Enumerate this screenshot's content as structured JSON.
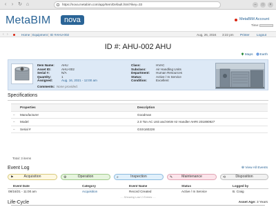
{
  "browser": {
    "url": "https://nova.metabim.com/app/Item/Default.html?ikey=33"
  },
  "header": {
    "logo": "MetaBIM",
    "badge": "nova",
    "account": "MetaBIM Account",
    "timer_label": "Time:"
  },
  "breadcrumb": {
    "home": "Home",
    "equipment": "Equipment",
    "asset": "ID #AHU-002",
    "date": "Aug, 26, 2024",
    "time": "3:22 pm",
    "print": "Printer",
    "logout": "Logout"
  },
  "page": {
    "title": "ID #:  AHU-002  AHU",
    "maps_link": "Maps",
    "earth_link": "Earth"
  },
  "asset": {
    "left": [
      {
        "k": "Item Name:",
        "v": "AHU"
      },
      {
        "k": "Asset ID:",
        "v": "AHU-002"
      },
      {
        "k": "Serial #:",
        "v": "N/A"
      },
      {
        "k": "Quantity:",
        "v": "1"
      },
      {
        "k": "Assigned:",
        "v": "Aug. 16, 2021 - 12:00 am"
      }
    ],
    "right": [
      {
        "k": "Class:",
        "v": "HVAC"
      },
      {
        "k": "Subclass:",
        "v": "Air Handling Units"
      },
      {
        "k": "Department:",
        "v": "Human Resources"
      },
      {
        "k": "Status:",
        "v": "Active / In Service"
      },
      {
        "k": "Condition:",
        "v": "Excellent"
      }
    ],
    "comments_label": "Comments:",
    "comments_value": "None provided."
  },
  "specs": {
    "title": "Specifications",
    "headers": [
      "Properties",
      "Description"
    ],
    "rows": [
      {
        "prop": "Manufacturer",
        "desc": "Goodman"
      },
      {
        "prop": "Model",
        "desc": "2.0 Ton AC Unit and 6KW Air Handler AHRI 201890927"
      },
      {
        "prop": "Serial #",
        "desc": "GSX160228"
      }
    ],
    "total": "Total: 3 items"
  },
  "event_log": {
    "title": "Event Log",
    "view_all": "View All Events",
    "stages": [
      "Acquisition",
      "Operation",
      "Inspection",
      "Maintenance",
      "Disposition"
    ],
    "headers": [
      "Event Date",
      "Category",
      "Event Name",
      "Status",
      "Logged by"
    ],
    "rows": [
      {
        "date": "08/16/21 - 11:00 am",
        "category": "Acquisition",
        "name": "Record Created",
        "status": "Active / In Service",
        "by": "B. Craig"
      }
    ],
    "showing": "- - Showing Last 1 Events - -"
  },
  "life_cycle": {
    "title": "Life-Cycle",
    "age_label": "Asset Age:",
    "age_value": "3 Years"
  }
}
